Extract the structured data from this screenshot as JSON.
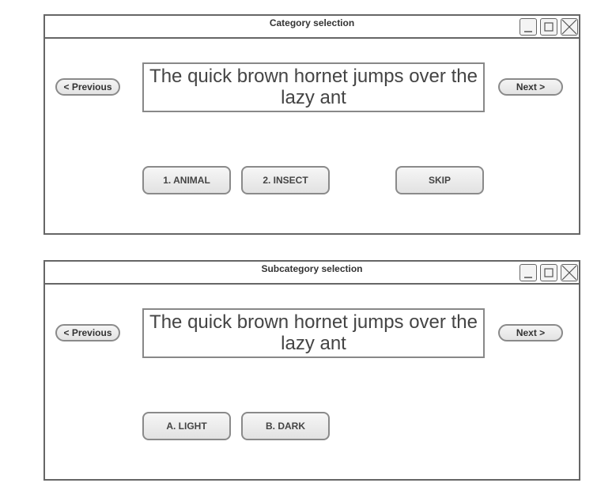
{
  "colors": {
    "border": "#666666",
    "button_border": "#8a8a8a",
    "text": "#333333"
  },
  "category_window": {
    "title": "Category selection",
    "previous_label": "< Previous",
    "next_label": "Next >",
    "sentence": "The quick brown hornet jumps over the lazy ant",
    "choices": [
      "1. ANIMAL",
      "2. INSECT"
    ],
    "skip_label": "SKIP",
    "icons": [
      "minimize-icon",
      "maximize-icon",
      "close-icon"
    ]
  },
  "subcategory_window": {
    "title": "Subcategory selection",
    "previous_label": "< Previous",
    "next_label": "Next >",
    "sentence": "The quick brown hornet jumps over the lazy ant",
    "choices": [
      "A. LIGHT",
      "B. DARK"
    ],
    "icons": [
      "minimize-icon",
      "maximize-icon",
      "close-icon"
    ]
  }
}
